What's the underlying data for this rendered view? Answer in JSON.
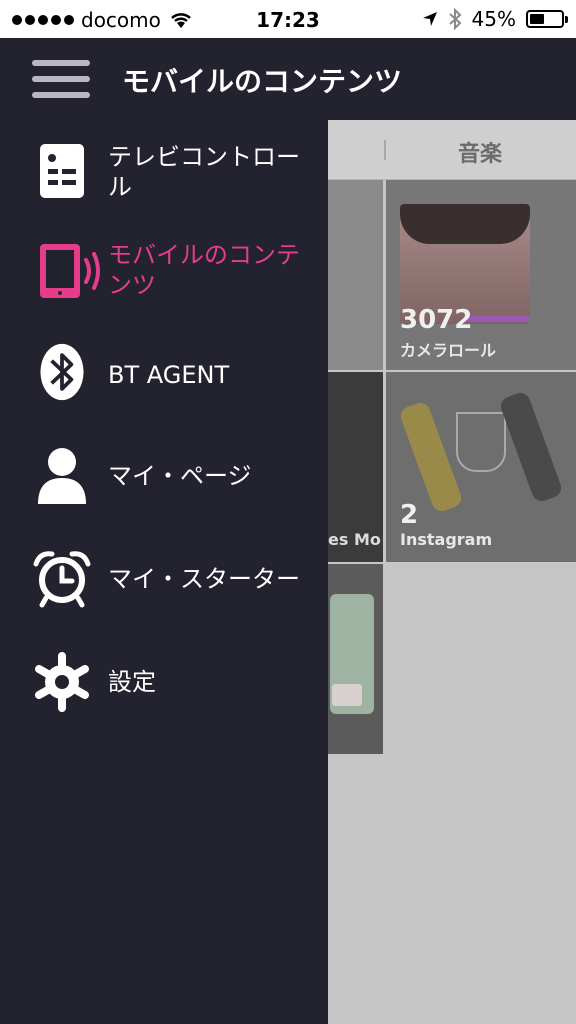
{
  "status_bar": {
    "carrier": "docomo",
    "time": "17:23",
    "battery": "45%",
    "battery_level": 0.45
  },
  "header": {
    "title": "モバイルのコンテンツ",
    "menu_icon": "hamburger-menu-icon"
  },
  "content": {
    "tab_music": "音楽",
    "tiles": [
      {
        "count": "3072",
        "label": "カメラロール"
      },
      {
        "count": "2",
        "label": "Instagram"
      }
    ],
    "partial_label": "es Mo"
  },
  "drawer": {
    "items": [
      {
        "label": "テレビコントロール",
        "icon": "remote-control-icon",
        "active": false
      },
      {
        "label": "モバイルのコンテンツ",
        "icon": "mobile-content-icon",
        "active": true
      },
      {
        "label": "BT AGENT",
        "icon": "bluetooth-icon",
        "active": false
      },
      {
        "label": "マイ・ページ",
        "icon": "user-icon",
        "active": false
      },
      {
        "label": "マイ・スターター",
        "icon": "alarm-clock-icon",
        "active": false
      },
      {
        "label": "設定",
        "icon": "gear-icon",
        "active": false
      }
    ]
  },
  "colors": {
    "drawer_bg": "#23222f",
    "accent": "#e63d8b",
    "text": "#ffffff"
  }
}
